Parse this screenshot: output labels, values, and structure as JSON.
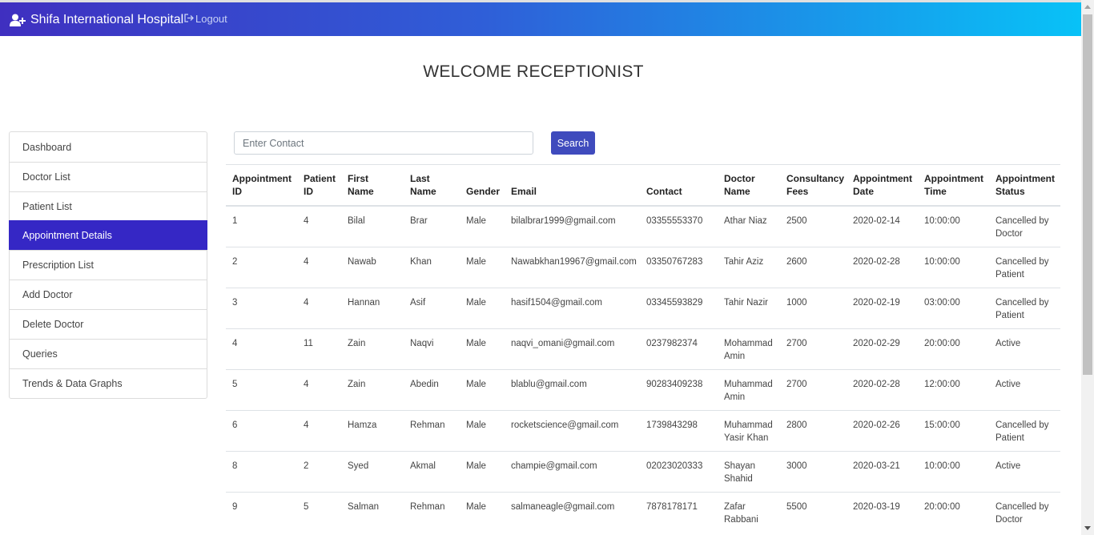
{
  "header": {
    "brand": "Shifa International Hospital",
    "logout_label": "Logout"
  },
  "welcome": "WELCOME RECEPTIONIST",
  "sidebar": {
    "items": [
      {
        "label": "Dashboard",
        "active": false
      },
      {
        "label": "Doctor List",
        "active": false
      },
      {
        "label": "Patient List",
        "active": false
      },
      {
        "label": "Appointment Details",
        "active": true
      },
      {
        "label": "Prescription List",
        "active": false
      },
      {
        "label": "Add Doctor",
        "active": false
      },
      {
        "label": "Delete Doctor",
        "active": false
      },
      {
        "label": "Queries",
        "active": false
      },
      {
        "label": "Trends & Data Graphs",
        "active": false
      }
    ]
  },
  "search": {
    "placeholder": "Enter Contact",
    "button_label": "Search"
  },
  "table": {
    "columns": [
      "Appointment ID",
      "Patient ID",
      "First Name",
      "Last Name",
      "Gender",
      "Email",
      "Contact",
      "Doctor Name",
      "Consultancy Fees",
      "Appointment Date",
      "Appointment Time",
      "Appointment Status"
    ],
    "rows": [
      [
        "1",
        "4",
        "Bilal",
        "Brar",
        "Male",
        "bilalbrar1999@gmail.com",
        "03355553370",
        "Athar Niaz",
        "2500",
        "2020-02-14",
        "10:00:00",
        "Cancelled by Doctor"
      ],
      [
        "2",
        "4",
        "Nawab",
        "Khan",
        "Male",
        "Nawabkhan19967@gmail.com",
        "03350767283",
        "Tahir Aziz",
        "2600",
        "2020-02-28",
        "10:00:00",
        "Cancelled by Patient"
      ],
      [
        "3",
        "4",
        "Hannan",
        "Asif",
        "Male",
        "hasif1504@gmail.com",
        "03345593829",
        "Tahir Nazir",
        "1000",
        "2020-02-19",
        "03:00:00",
        "Cancelled by Patient"
      ],
      [
        "4",
        "11",
        "Zain",
        "Naqvi",
        "Male",
        "naqvi_omani@gmail.com",
        "0237982374",
        "Mohammad Amin",
        "2700",
        "2020-02-29",
        "20:00:00",
        "Active"
      ],
      [
        "5",
        "4",
        "Zain",
        "Abedin",
        "Male",
        "blablu@gmail.com",
        "90283409238",
        "Muhammad Amin",
        "2700",
        "2020-02-28",
        "12:00:00",
        "Active"
      ],
      [
        "6",
        "4",
        "Hamza",
        "Rehman",
        "Male",
        "rocketscience@gmail.com",
        "1739843298",
        "Muhammad Yasir Khan",
        "2800",
        "2020-02-26",
        "15:00:00",
        "Cancelled by Patient"
      ],
      [
        "8",
        "2",
        "Syed",
        "Akmal",
        "Male",
        "champie@gmail.com",
        "02023020333",
        "Shayan Shahid",
        "3000",
        "2020-03-21",
        "10:00:00",
        "Active"
      ],
      [
        "9",
        "5",
        "Salman",
        "Rehman",
        "Male",
        "salmaneagle@gmail.com",
        "7878178171",
        "Zafar Rabbani",
        "5500",
        "2020-03-19",
        "20:00:00",
        "Cancelled by Doctor"
      ]
    ]
  },
  "colors": {
    "accent": "#3527c5",
    "button": "#3f4bbd",
    "gradient_start": "#3f2fc0",
    "gradient_end": "#08c2f7"
  }
}
